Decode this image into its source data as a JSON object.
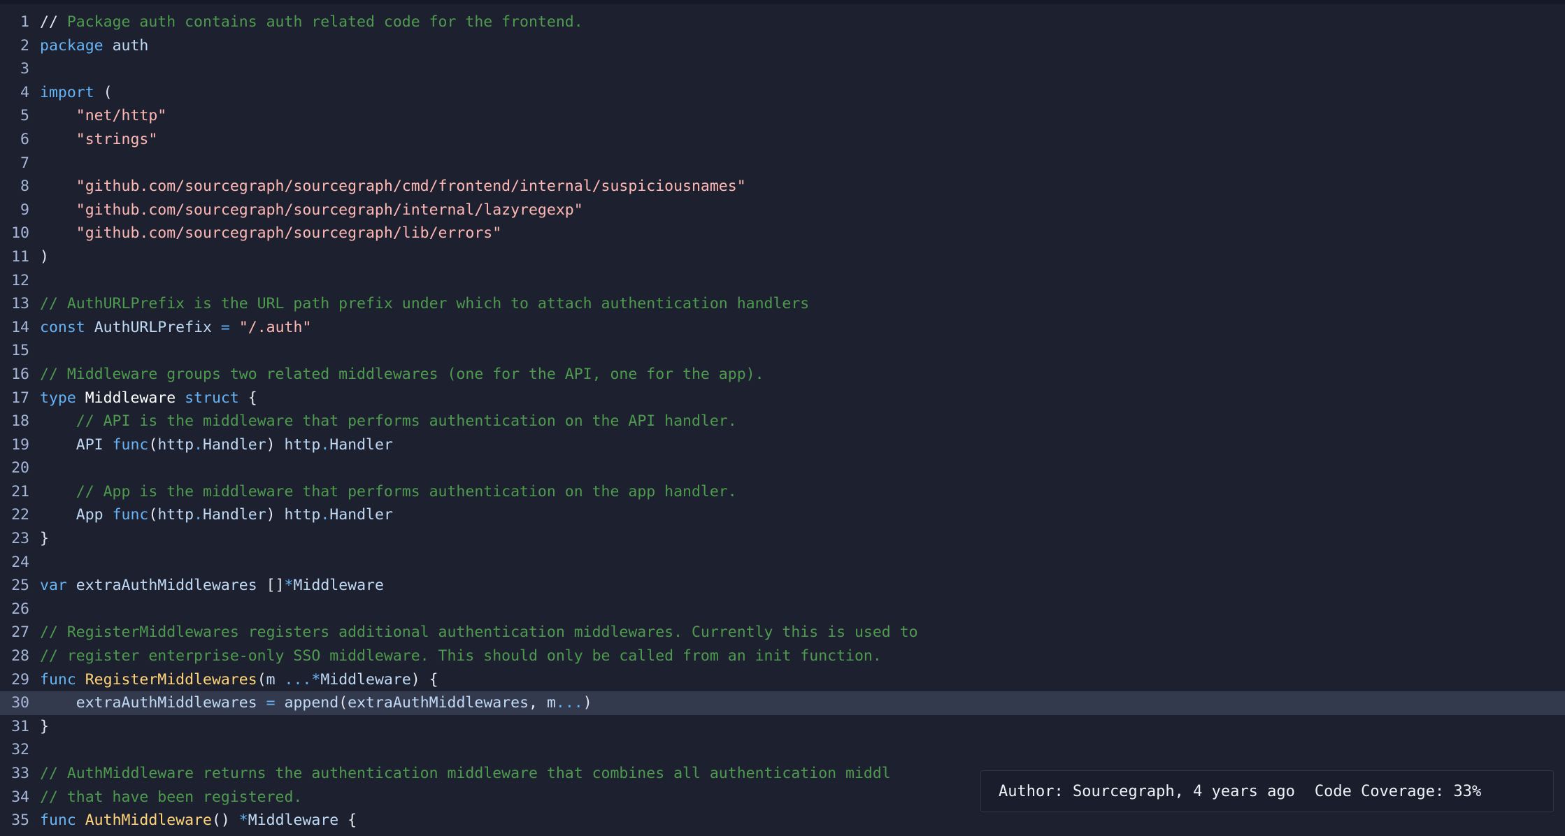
{
  "editor": {
    "language": "go",
    "active_line": 30,
    "lines": [
      {
        "n": "1",
        "tokens": [
          {
            "c": "plain",
            "t": "// "
          },
          {
            "c": "comment",
            "t": "Package auth contains auth related code for the frontend."
          }
        ]
      },
      {
        "n": "2",
        "tokens": [
          {
            "c": "kw",
            "t": "package"
          },
          {
            "c": "plain",
            "t": " "
          },
          {
            "c": "ident",
            "t": "auth"
          }
        ]
      },
      {
        "n": "3",
        "tokens": []
      },
      {
        "n": "4",
        "tokens": [
          {
            "c": "kw",
            "t": "import"
          },
          {
            "c": "plain",
            "t": " ("
          }
        ]
      },
      {
        "n": "5",
        "tokens": [
          {
            "c": "plain",
            "t": "    "
          },
          {
            "c": "str",
            "t": "\"net/http\""
          }
        ]
      },
      {
        "n": "6",
        "tokens": [
          {
            "c": "plain",
            "t": "    "
          },
          {
            "c": "str",
            "t": "\"strings\""
          }
        ]
      },
      {
        "n": "7",
        "tokens": []
      },
      {
        "n": "8",
        "tokens": [
          {
            "c": "plain",
            "t": "    "
          },
          {
            "c": "str",
            "t": "\"github.com/sourcegraph/sourcegraph/cmd/frontend/internal/suspiciousnames\""
          }
        ]
      },
      {
        "n": "9",
        "tokens": [
          {
            "c": "plain",
            "t": "    "
          },
          {
            "c": "str",
            "t": "\"github.com/sourcegraph/sourcegraph/internal/lazyregexp\""
          }
        ]
      },
      {
        "n": "10",
        "tokens": [
          {
            "c": "plain",
            "t": "    "
          },
          {
            "c": "str",
            "t": "\"github.com/sourcegraph/sourcegraph/lib/errors\""
          }
        ]
      },
      {
        "n": "11",
        "tokens": [
          {
            "c": "plain",
            "t": ")"
          }
        ]
      },
      {
        "n": "12",
        "tokens": []
      },
      {
        "n": "13",
        "tokens": [
          {
            "c": "comment",
            "t": "// AuthURLPrefix is the URL path prefix under which to attach authentication handlers"
          }
        ]
      },
      {
        "n": "14",
        "tokens": [
          {
            "c": "kw",
            "t": "const"
          },
          {
            "c": "plain",
            "t": " "
          },
          {
            "c": "ident",
            "t": "AuthURLPrefix"
          },
          {
            "c": "plain",
            "t": " "
          },
          {
            "c": "op",
            "t": "="
          },
          {
            "c": "plain",
            "t": " "
          },
          {
            "c": "str",
            "t": "\"/.auth\""
          }
        ]
      },
      {
        "n": "15",
        "tokens": []
      },
      {
        "n": "16",
        "tokens": [
          {
            "c": "comment",
            "t": "// Middleware groups two related middlewares (one for the API, one for the app)."
          }
        ]
      },
      {
        "n": "17",
        "tokens": [
          {
            "c": "kw",
            "t": "type"
          },
          {
            "c": "plain",
            "t": " "
          },
          {
            "c": "sym",
            "t": "Middleware"
          },
          {
            "c": "plain",
            "t": " "
          },
          {
            "c": "kw",
            "t": "struct"
          },
          {
            "c": "plain",
            "t": " {"
          }
        ]
      },
      {
        "n": "18",
        "tokens": [
          {
            "c": "plain",
            "t": "    "
          },
          {
            "c": "comment",
            "t": "// API is the middleware that performs authentication on the API handler."
          }
        ]
      },
      {
        "n": "19",
        "tokens": [
          {
            "c": "plain",
            "t": "    "
          },
          {
            "c": "ident",
            "t": "API"
          },
          {
            "c": "plain",
            "t": " "
          },
          {
            "c": "kw",
            "t": "func"
          },
          {
            "c": "plain",
            "t": "("
          },
          {
            "c": "ident",
            "t": "http"
          },
          {
            "c": "op",
            "t": "."
          },
          {
            "c": "type",
            "t": "Handler"
          },
          {
            "c": "plain",
            "t": ") "
          },
          {
            "c": "ident",
            "t": "http"
          },
          {
            "c": "op",
            "t": "."
          },
          {
            "c": "type",
            "t": "Handler"
          }
        ]
      },
      {
        "n": "20",
        "tokens": []
      },
      {
        "n": "21",
        "tokens": [
          {
            "c": "plain",
            "t": "    "
          },
          {
            "c": "comment",
            "t": "// App is the middleware that performs authentication on the app handler."
          }
        ]
      },
      {
        "n": "22",
        "tokens": [
          {
            "c": "plain",
            "t": "    "
          },
          {
            "c": "ident",
            "t": "App"
          },
          {
            "c": "plain",
            "t": " "
          },
          {
            "c": "kw",
            "t": "func"
          },
          {
            "c": "plain",
            "t": "("
          },
          {
            "c": "ident",
            "t": "http"
          },
          {
            "c": "op",
            "t": "."
          },
          {
            "c": "type",
            "t": "Handler"
          },
          {
            "c": "plain",
            "t": ") "
          },
          {
            "c": "ident",
            "t": "http"
          },
          {
            "c": "op",
            "t": "."
          },
          {
            "c": "type",
            "t": "Handler"
          }
        ]
      },
      {
        "n": "23",
        "tokens": [
          {
            "c": "plain",
            "t": "}"
          }
        ]
      },
      {
        "n": "24",
        "tokens": []
      },
      {
        "n": "25",
        "tokens": [
          {
            "c": "kw",
            "t": "var"
          },
          {
            "c": "plain",
            "t": " "
          },
          {
            "c": "ident",
            "t": "extraAuthMiddlewares"
          },
          {
            "c": "plain",
            "t": " []"
          },
          {
            "c": "op",
            "t": "*"
          },
          {
            "c": "type",
            "t": "Middleware"
          }
        ]
      },
      {
        "n": "26",
        "tokens": []
      },
      {
        "n": "27",
        "tokens": [
          {
            "c": "comment",
            "t": "// RegisterMiddlewares registers additional authentication middlewares. Currently this is used to"
          }
        ]
      },
      {
        "n": "28",
        "tokens": [
          {
            "c": "comment",
            "t": "// register enterprise-only SSO middleware. This should only be called from an init function."
          }
        ]
      },
      {
        "n": "29",
        "tokens": [
          {
            "c": "kw",
            "t": "func"
          },
          {
            "c": "plain",
            "t": " "
          },
          {
            "c": "fn",
            "t": "RegisterMiddlewares"
          },
          {
            "c": "plain",
            "t": "("
          },
          {
            "c": "ident",
            "t": "m"
          },
          {
            "c": "plain",
            "t": " "
          },
          {
            "c": "op",
            "t": "...*"
          },
          {
            "c": "type",
            "t": "Middleware"
          },
          {
            "c": "plain",
            "t": ") {"
          }
        ]
      },
      {
        "n": "30",
        "tokens": [
          {
            "c": "plain",
            "t": "    "
          },
          {
            "c": "ident",
            "t": "extraAuthMiddlewares"
          },
          {
            "c": "plain",
            "t": " "
          },
          {
            "c": "op",
            "t": "="
          },
          {
            "c": "plain",
            "t": " "
          },
          {
            "c": "ident",
            "t": "append"
          },
          {
            "c": "plain",
            "t": "("
          },
          {
            "c": "ident",
            "t": "extraAuthMiddlewares"
          },
          {
            "c": "plain",
            "t": ", "
          },
          {
            "c": "ident",
            "t": "m"
          },
          {
            "c": "op",
            "t": "..."
          },
          {
            "c": "plain",
            "t": ")"
          }
        ]
      },
      {
        "n": "31",
        "tokens": [
          {
            "c": "plain",
            "t": "}"
          }
        ]
      },
      {
        "n": "32",
        "tokens": []
      },
      {
        "n": "33",
        "tokens": [
          {
            "c": "comment",
            "t": "// AuthMiddleware returns the authentication middleware that combines all authentication middl"
          }
        ]
      },
      {
        "n": "34",
        "tokens": [
          {
            "c": "comment",
            "t": "// that have been registered."
          }
        ]
      },
      {
        "n": "35",
        "tokens": [
          {
            "c": "kw",
            "t": "func"
          },
          {
            "c": "plain",
            "t": " "
          },
          {
            "c": "fn",
            "t": "AuthMiddleware"
          },
          {
            "c": "plain",
            "t": "() "
          },
          {
            "c": "op",
            "t": "*"
          },
          {
            "c": "type",
            "t": "Middleware"
          },
          {
            "c": "plain",
            "t": " {"
          }
        ]
      }
    ]
  },
  "tooltip": {
    "author": "Author: Sourcegraph, 4 years ago",
    "coverage": "Code Coverage: 33%"
  },
  "colors": {
    "background": "#1d212f",
    "active_line": "#343a4d",
    "comment": "#4e9a4e",
    "keyword": "#66b3f5",
    "string": "#ffb8b3",
    "function": "#ffd479"
  }
}
